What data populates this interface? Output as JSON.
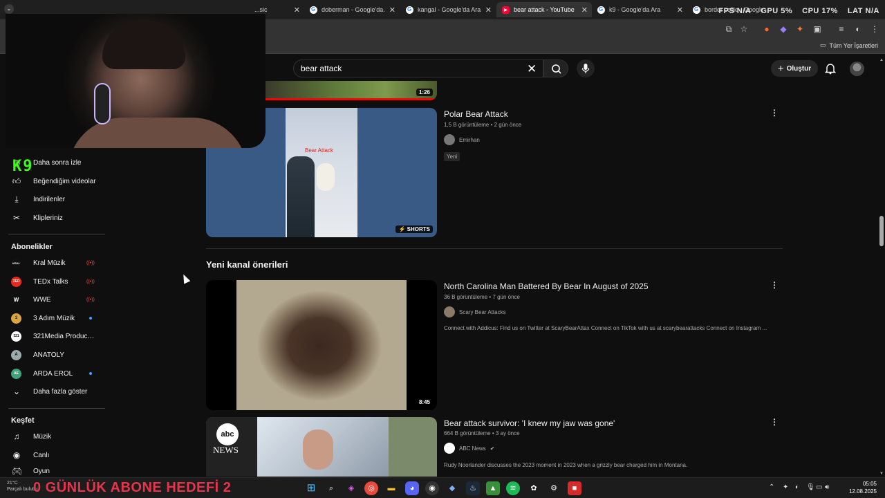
{
  "browser": {
    "tabs": [
      {
        "title": "...sic",
        "active": false
      },
      {
        "title": "doberman - Google'da Ara",
        "active": false
      },
      {
        "title": "kangal - Google'da Ara",
        "active": false
      },
      {
        "title": "bear attack - YouTube",
        "active": true
      },
      {
        "title": "k9 - Google'da Ara",
        "active": false
      },
      {
        "title": "border collie - Google'da",
        "active": false
      }
    ],
    "bookmarks_folder": "Tüm Yer İşaretleri"
  },
  "hud": {
    "fps": "FPS N/A",
    "gpu": "GPU 5%",
    "cpu": "CPU 17%",
    "lat": "LAT N/A"
  },
  "header": {
    "search_value": "bear attack",
    "create_label": "Oluştur"
  },
  "overlay": {
    "logo": "K9"
  },
  "sidebar": {
    "library_items": [
      {
        "label": "Daha sonra izle",
        "icon": "clock-icon"
      },
      {
        "label": "Beğendiğim videolar",
        "icon": "thumbs-up-icon"
      },
      {
        "label": "İndirilenler",
        "icon": "download-icon"
      },
      {
        "label": "Klipleriniz",
        "icon": "scissors-icon"
      }
    ],
    "subscriptions_heading": "Abonelikler",
    "subscriptions": [
      {
        "label": "Kral Müzik",
        "avatar": "KRAL",
        "status": "live"
      },
      {
        "label": "TEDx Talks",
        "avatar": "TED",
        "status": "live"
      },
      {
        "label": "WWE",
        "avatar": "W",
        "status": "live"
      },
      {
        "label": "3 Adım Müzik",
        "avatar": "3",
        "status": "new"
      },
      {
        "label": "321Media Producti...",
        "avatar": "321",
        "status": ""
      },
      {
        "label": "ANATOLY",
        "avatar": "A",
        "status": ""
      },
      {
        "label": "ARDA EROL",
        "avatar": "AE",
        "status": "new"
      }
    ],
    "show_more": "Daha fazla göster",
    "explore_heading": "Keşfet",
    "explore_items": [
      {
        "label": "Müzik",
        "icon": "music-note-icon"
      },
      {
        "label": "Canlı",
        "icon": "live-icon"
      },
      {
        "label": "Oyun",
        "icon": "gamepad-icon"
      }
    ]
  },
  "results": {
    "partial_top": {
      "duration": "1:26"
    },
    "videos": [
      {
        "title": "Polar Bear Attack",
        "meta": "1,5 B görüntüleme • 2 gün önce",
        "channel": "Emirhan",
        "badge": "Yeni",
        "thumb_text": "Bear Attack",
        "duration": "SHORTS",
        "description": ""
      }
    ],
    "section_heading": "Yeni kanal önerileri",
    "recommended": [
      {
        "title": "North Carolina Man Battered By Bear In August of 2025",
        "meta": "36 B görüntüleme • 7 gün önce",
        "channel": "Scary Bear Attacks",
        "description": "Connect with Addicus: Find us on Twitter at ScaryBearAttax Connect on TikTok with us at scarybearattacks Connect on Instagram ...",
        "duration": "8:45"
      },
      {
        "title": "Bear attack survivor: 'I knew my jaw was gone'",
        "meta": "664 B görüntüleme • 3 ay önce",
        "channel": "ABC News",
        "description": "Rudy Noorlander discusses the 2023 moment in 2023 when a grizzly bear charged him in Montana.",
        "thumb_logo_top": "abc",
        "thumb_logo_bottom": "NEWS"
      }
    ]
  },
  "taskbar": {
    "weather_temp": "21°C",
    "weather_text": "Parçalı bulutlu",
    "goal_text": "0  GÜNLÜK ABONE HEDEFİ  2",
    "time": "05:05",
    "date": "12.08.2025"
  }
}
